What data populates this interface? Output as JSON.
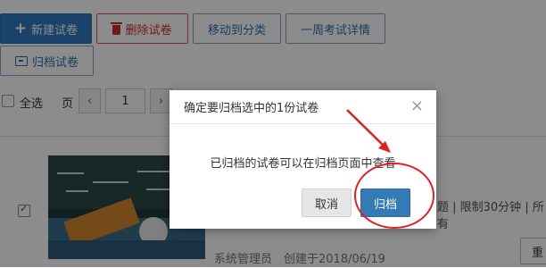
{
  "toolbar": {
    "new_exam": "新建试卷",
    "delete_exam": "删除试卷",
    "move_category": "移动到分类",
    "week_details": "一周考试详情",
    "archive_exam": "归档试卷"
  },
  "listbar": {
    "select_all": "全选",
    "page_label": "页",
    "page_value": "1"
  },
  "card": {
    "meta_right": "题 | 限制30分钟 | 所有",
    "author": "系统管理员",
    "created": "创建于2018/06/19",
    "action_label": "重"
  },
  "dialog": {
    "title": "确定要归档选中的1份试卷",
    "close_glyph": "×",
    "message": "已归档的试卷可以在归档页面中查看",
    "cancel": "取消",
    "confirm": "归档"
  },
  "colors": {
    "primary": "#2f7ac4",
    "danger": "#c9302c",
    "annotation": "#e02020"
  }
}
